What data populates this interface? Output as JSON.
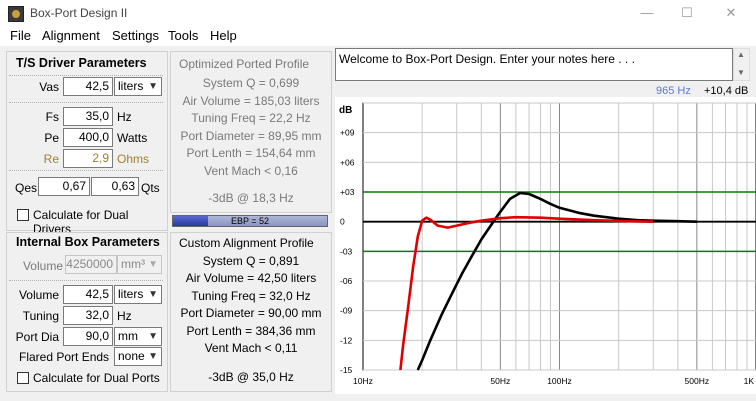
{
  "window": {
    "title": "Box-Port Design II",
    "minimize": "—",
    "maximize": "☐",
    "close": "✕"
  },
  "menu": [
    "File",
    "Alignment",
    "Settings",
    "Tools",
    "Help"
  ],
  "ts": {
    "header": "T/S Driver Parameters",
    "vas_label": "Vas",
    "vas_value": "42,5",
    "vas_unit": "liters",
    "fs_label": "Fs",
    "fs_value": "35,0",
    "fs_unit": "Hz",
    "pe_label": "Pe",
    "pe_value": "400,0",
    "pe_unit": "Watts",
    "re_label": "Re",
    "re_value": "2,9",
    "re_unit": "Ohms",
    "qes_label": "Qes",
    "qes_value": "0,67",
    "qts_value": "0,63",
    "qts_label": "Qts",
    "dual_label": "Calculate for Dual Drivers"
  },
  "box": {
    "header": "Internal Box Parameters",
    "volume_label": "Volume",
    "volume_mm_value": "4250000",
    "volume_mm_unit": "mm³",
    "volume_value": "42,5",
    "volume_unit": "liters",
    "tuning_label": "Tuning",
    "tuning_value": "32,0",
    "tuning_unit": "Hz",
    "portdia_label": "Port Dia",
    "portdia_value": "90,0",
    "portdia_unit": "mm",
    "flared_label": "Flared Port Ends",
    "flared_value": "none",
    "dual_label": "Calculate for Dual Ports"
  },
  "optimized": {
    "header": "Optimized Ported Profile",
    "lines": [
      "System Q = 0,699",
      "Air Volume = 185,03 liters",
      "Tuning Freq = 22,2 Hz",
      "Port Diameter = 89,95 mm",
      "Port Lenth = 154,64 mm",
      "Vent Mach < 0,16"
    ],
    "minus3db": "-3dB @ 18,3 Hz"
  },
  "ebp": {
    "label": "EBP = 52",
    "value": 52
  },
  "custom": {
    "header": "Custom Alignment Profile",
    "lines": [
      "System Q = 0,891",
      "Air Volume = 42,50 liters",
      "Tuning Freq = 32,0 Hz",
      "Port Diameter = 90,00 mm",
      "Port Lenth = 384,36 mm",
      "Vent Mach < 0,11"
    ],
    "minus3db": "-3dB @ 35,0 Hz"
  },
  "notes": {
    "text": "Welcome to Box-Port Design.  Enter your notes here . . ."
  },
  "graph": {
    "cursor_freq": "965 Hz",
    "cursor_db": "+10,4 dB",
    "colors": {
      "custom": "#e00000",
      "optimized": "#000000",
      "ref": "#008000",
      "zero": "#000000"
    },
    "chart_data": {
      "type": "line",
      "ylabel": "dB",
      "x_scale": "log",
      "xlim": [
        10,
        1000
      ],
      "ylim": [
        -15,
        12
      ],
      "y_ticks": [
        "+09",
        "+06",
        "+03",
        "0",
        "-03",
        "-06",
        "-09",
        "-12",
        "-15"
      ],
      "y_tick_values": [
        9,
        6,
        3,
        0,
        -3,
        -6,
        -9,
        -12,
        -15
      ],
      "x_tick_labels": [
        "10Hz",
        "50Hz",
        "100Hz",
        "500Hz",
        "1K"
      ],
      "x_tick_values": [
        10,
        50,
        100,
        500,
        1000
      ],
      "reference_lines": [
        3,
        -3
      ],
      "series": [
        {
          "key": "optimized",
          "x": [
            19,
            20,
            22,
            25,
            28,
            32,
            36,
            40,
            45,
            50,
            56,
            63,
            70,
            80,
            90,
            100,
            125,
            150,
            200,
            250,
            300,
            400,
            500
          ],
          "y": [
            -15,
            -14,
            -12,
            -9.5,
            -7.5,
            -5.2,
            -3.4,
            -1.8,
            -0.3,
            1.0,
            2.3,
            2.9,
            2.8,
            2.3,
            1.8,
            1.4,
            0.9,
            0.6,
            0.3,
            0.15,
            0.1,
            0.05,
            0
          ]
        },
        {
          "key": "custom",
          "x": [
            15.5,
            16,
            17,
            18,
            19,
            20,
            21,
            22,
            24,
            27,
            30,
            35,
            40,
            50,
            60,
            80,
            100,
            150,
            200,
            300
          ],
          "y": [
            -15,
            -12.5,
            -8.5,
            -4.5,
            -1.5,
            0.1,
            0.4,
            0.2,
            -0.4,
            -0.6,
            -0.4,
            -0.1,
            0.1,
            0.35,
            0.45,
            0.4,
            0.3,
            0.15,
            0.08,
            0
          ]
        }
      ]
    }
  }
}
